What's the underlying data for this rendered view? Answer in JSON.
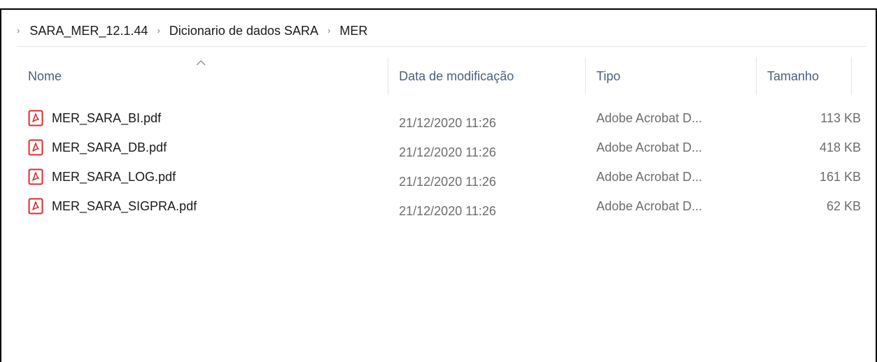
{
  "breadcrumb": {
    "items": [
      {
        "label": "SARA_MER_12.1.44"
      },
      {
        "label": "Dicionario de dados SARA"
      },
      {
        "label": "MER"
      }
    ]
  },
  "columns": {
    "name": "Nome",
    "date": "Data de modificação",
    "type": "Tipo",
    "size": "Tamanho",
    "sorted_by": "name"
  },
  "files": [
    {
      "name": "MER_SARA_BI.pdf",
      "date": "21/12/2020 11:26",
      "type": "Adobe Acrobat D...",
      "size": "113 KB",
      "icon": "pdf-icon"
    },
    {
      "name": "MER_SARA_DB.pdf",
      "date": "21/12/2020 11:26",
      "type": "Adobe Acrobat D...",
      "size": "418 KB",
      "icon": "pdf-icon"
    },
    {
      "name": "MER_SARA_LOG.pdf",
      "date": "21/12/2020 11:26",
      "type": "Adobe Acrobat D...",
      "size": "161 KB",
      "icon": "pdf-icon"
    },
    {
      "name": "MER_SARA_SIGPRA.pdf",
      "date": "21/12/2020 11:26",
      "type": "Adobe Acrobat D...",
      "size": "62 KB",
      "icon": "pdf-icon"
    }
  ],
  "colors": {
    "header_text": "#4c607a",
    "pdf_icon": "#e02b2b",
    "secondary_text": "#6d6d6d"
  }
}
